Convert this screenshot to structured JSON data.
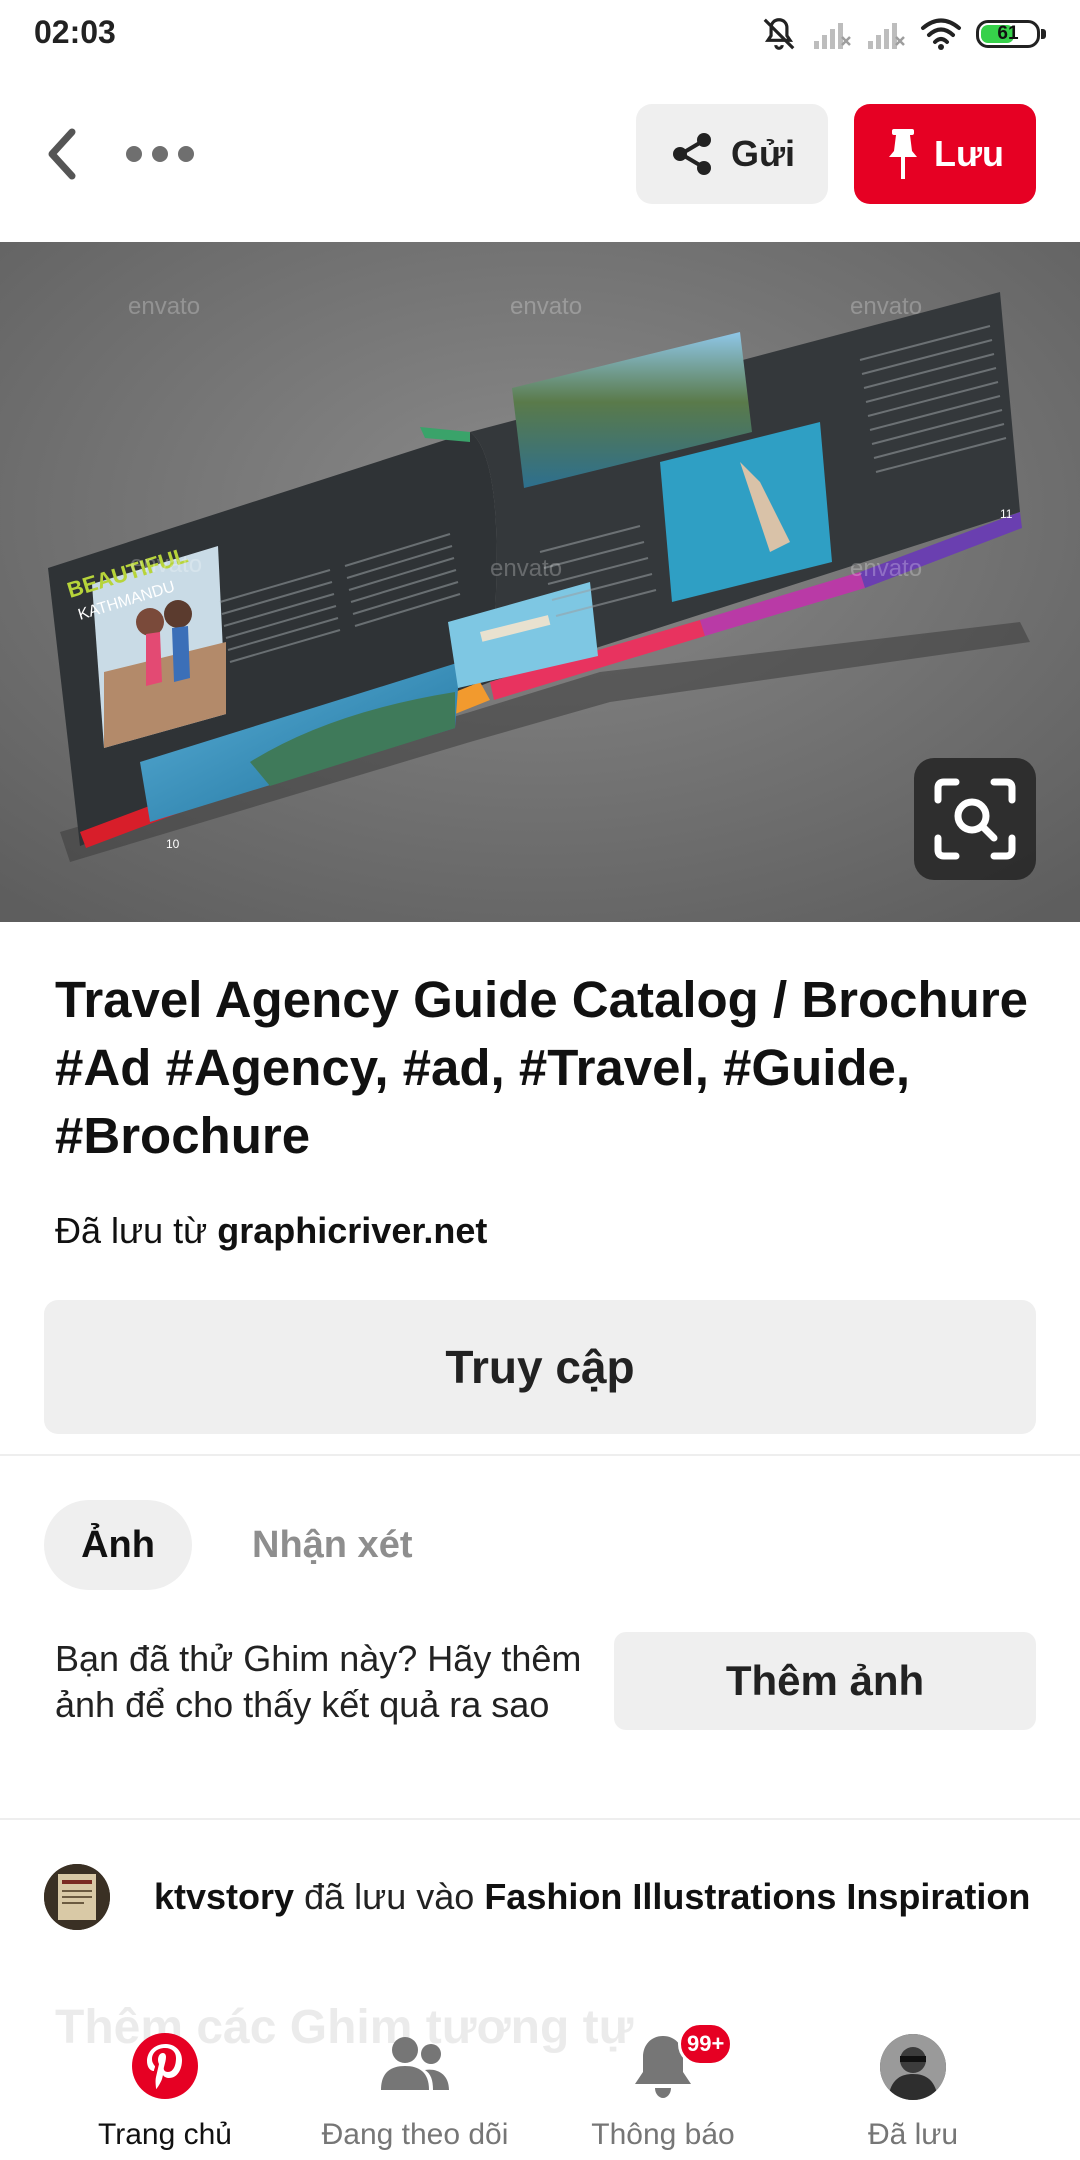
{
  "status_bar": {
    "time": "02:03",
    "battery_percent": "61",
    "battery_level": 0.61,
    "icons": [
      "mute-bell-icon",
      "signal-off-icon",
      "signal-off-icon",
      "wifi-icon",
      "battery-icon"
    ]
  },
  "top_bar": {
    "send_label": "Gửi",
    "save_label": "Lưu"
  },
  "pin_image": {
    "brochure_heading_line1": "BEAUTIFUL",
    "brochure_heading_line2": "KATHMANDU",
    "watermark": "envato",
    "page_left_number": "10",
    "page_right_number": "11"
  },
  "pin": {
    "title": "Travel Agency Guide Catalog / Brochure #Ad #Agency, #ad, #Travel, #Guide, #Brochure",
    "saved_from_prefix": "Đã lưu từ",
    "saved_from_domain": "graphicriver.net",
    "visit_label": "Truy cập"
  },
  "tabs": {
    "photos_label": "Ảnh",
    "comments_label": "Nhận xét"
  },
  "tried": {
    "prompt": "Bạn đã thử Ghim này? Hãy thêm ảnh để cho thấy kết quả ra sao",
    "add_photo_label": "Thêm ảnh"
  },
  "activity": {
    "username": "ktvstory",
    "action": "đã lưu vào",
    "board": "Fashion Illustrations Inspiration"
  },
  "more_ideas_label": "Thêm các Ghim tương tự",
  "bottom_nav": {
    "home_label": "Trang chủ",
    "following_label": "Đang theo dõi",
    "notifications_label": "Thông báo",
    "notifications_badge": "99+",
    "saved_label": "Đã lưu"
  },
  "colors": {
    "brand_red": "#e60023",
    "button_gray": "#efefef",
    "muted_text": "#8e8e8e"
  }
}
